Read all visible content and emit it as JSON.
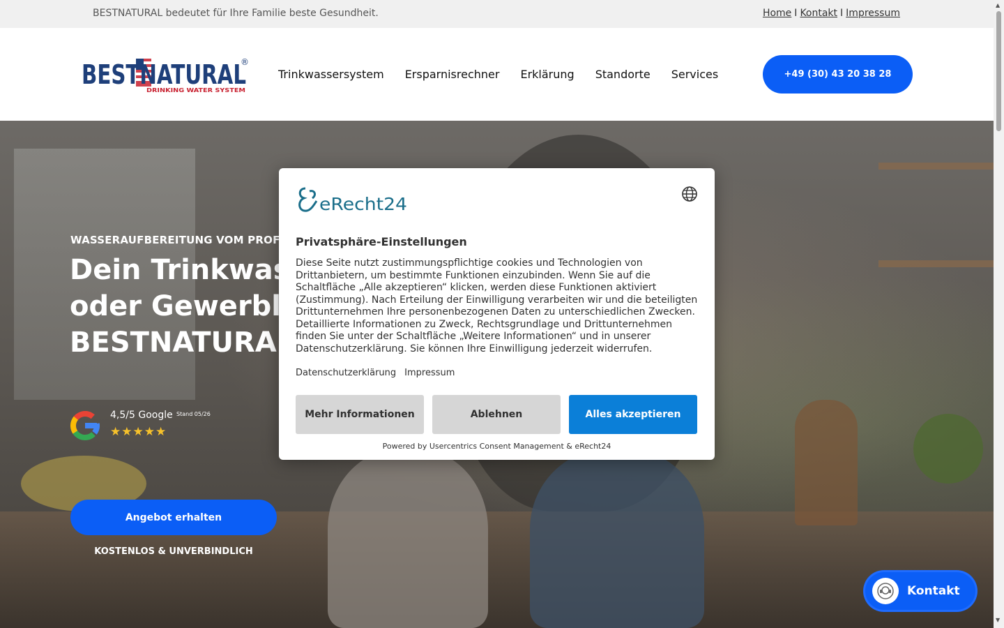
{
  "topbar": {
    "tagline": "BESTNATURAL bedeutet für Ihre Familie beste Gesundheit.",
    "links": [
      "Home",
      "Kontakt",
      "Impressum"
    ],
    "separator": "I"
  },
  "header": {
    "logo": {
      "main": "BESTNATURAL",
      "sub": "DRINKING WATER SYSTEM",
      "mark": "®"
    },
    "nav": [
      "Trinkwassersystem",
      "Ersparnisrechner",
      "Erklärung",
      "Standorte",
      "Services"
    ],
    "phone": "+49 (30) 43 20 38 28"
  },
  "hero": {
    "kicker": "WASSERAUFBEREITUNG VOM PROFI.",
    "title_bold": "Dein Trinkwass",
    "title_line2": "oder Gewerblic",
    "title_line3": "BESTNATURAL.",
    "rating": {
      "text": "4,5/5 Google",
      "stand": "Stand 05/26",
      "stars": "★★★★★"
    },
    "offer_button": "Angebot erhalten",
    "offer_note": "KOSTENLOS & UNVERBINDLICH"
  },
  "contact_fab": {
    "label": "Kontakt"
  },
  "consent": {
    "brand": "eRecht24",
    "title": "Privatsphäre-Einstellungen",
    "body": "Diese Seite nutzt zustimmungspflichtige cookies und Technologien von Drittanbietern, um bestimmte Funktionen einzubinden. Wenn Sie auf die Schaltfläche „Alle akzeptieren“ klicken, werden diese Funktionen aktiviert (Zustimmung). Nach Erteilung der Einwilligung verarbeiten wir und die beteiligten Drittunternehmen Ihre personenbezogenen Daten zu unterschiedlichen Zwecken. Detaillierte Informationen zu Zweck, Rechtsgrundlage und Drittunternehmen finden Sie unter der Schaltfläche „Weitere Informationen“ und in unserer Datenschutzerklärung. Sie können Ihre Einwilligung jederzeit widerrufen.",
    "links": [
      "Datenschutzerklärung",
      "Impressum"
    ],
    "buttons": {
      "more": "Mehr Informationen",
      "deny": "Ablehnen",
      "accept": "Alles akzeptieren"
    },
    "powered": "Powered by Usercentrics Consent Management & eRecht24"
  },
  "colors": {
    "primary": "#0b5ef6",
    "accept": "#0b7fd8",
    "teal": "#1a6e8a",
    "logo_blue": "#1e3f7a",
    "logo_red": "#c8202f"
  }
}
